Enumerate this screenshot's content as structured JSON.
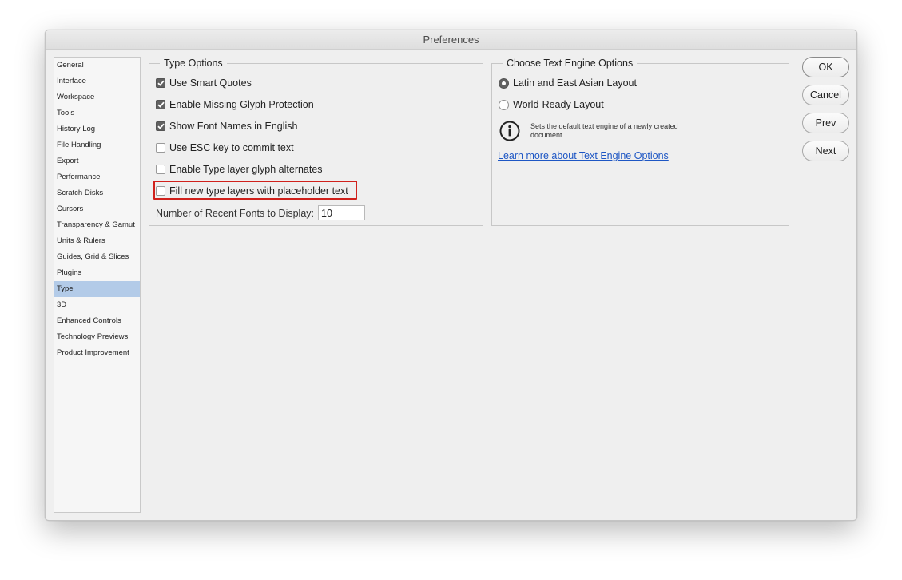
{
  "window": {
    "title": "Preferences"
  },
  "sidebar": {
    "items": [
      {
        "label": "General",
        "selected": false
      },
      {
        "label": "Interface",
        "selected": false
      },
      {
        "label": "Workspace",
        "selected": false
      },
      {
        "label": "Tools",
        "selected": false
      },
      {
        "label": "History Log",
        "selected": false
      },
      {
        "label": "File Handling",
        "selected": false
      },
      {
        "label": "Export",
        "selected": false
      },
      {
        "label": "Performance",
        "selected": false
      },
      {
        "label": "Scratch Disks",
        "selected": false
      },
      {
        "label": "Cursors",
        "selected": false
      },
      {
        "label": "Transparency & Gamut",
        "selected": false
      },
      {
        "label": "Units & Rulers",
        "selected": false
      },
      {
        "label": "Guides, Grid & Slices",
        "selected": false
      },
      {
        "label": "Plugins",
        "selected": false
      },
      {
        "label": "Type",
        "selected": true
      },
      {
        "label": "3D",
        "selected": false
      },
      {
        "label": "Enhanced Controls",
        "selected": false
      },
      {
        "label": "Technology Previews",
        "selected": false
      },
      {
        "label": "Product Improvement",
        "selected": false
      }
    ]
  },
  "type_options": {
    "title": "Type Options",
    "checkboxes": [
      {
        "label": "Use Smart Quotes",
        "checked": true
      },
      {
        "label": "Enable Missing Glyph Protection",
        "checked": true
      },
      {
        "label": "Show Font Names in English",
        "checked": true
      },
      {
        "label": "Use ESC key to commit text",
        "checked": false
      },
      {
        "label": "Enable Type layer glyph alternates",
        "checked": false
      },
      {
        "label": "Fill new type layers with placeholder text",
        "checked": false,
        "highlighted": true
      }
    ],
    "recent_fonts_label": "Number of Recent Fonts to Display:",
    "recent_fonts_value": "10"
  },
  "engine_options": {
    "title": "Choose Text Engine Options",
    "radios": [
      {
        "label": "Latin and East Asian Layout",
        "selected": true
      },
      {
        "label": "World-Ready Layout",
        "selected": false
      }
    ],
    "info_text": "Sets the default text engine of a newly created document",
    "info_icon": "info-icon",
    "learn_more_link": "Learn more about Text Engine Options"
  },
  "buttons": {
    "ok": "OK",
    "cancel": "Cancel",
    "prev": "Prev",
    "next": "Next"
  },
  "colors": {
    "selection": "#b3cbe8",
    "highlight_border": "#d0211c",
    "link": "#1d56c4"
  }
}
